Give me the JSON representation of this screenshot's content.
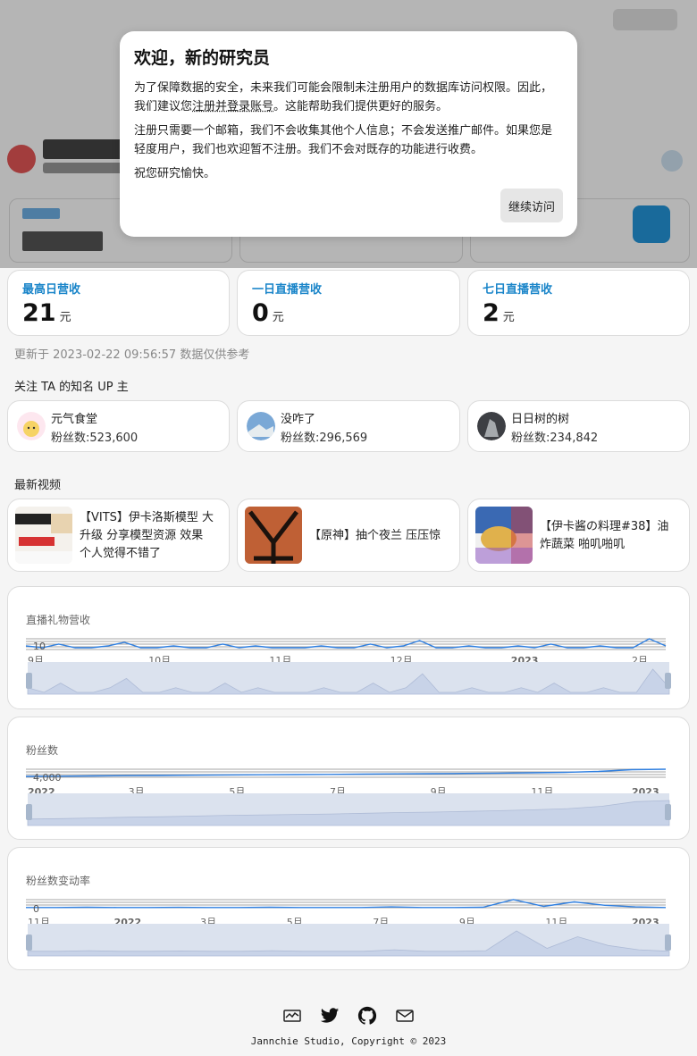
{
  "modal": {
    "title": "欢迎，新的研究员",
    "p1_before": "为了保障数据的安全，未来我们可能会限制未注册用户的数据库访问权限。因此，我们建议您",
    "p1_link": "注册并登录账号",
    "p1_after": "。这能帮助我们提供更好的服务。",
    "p2": "注册只需要一个邮箱，我们不会收集其他个人信息；不会发送推广邮件。如果您是轻度用户，我们也欢迎暂不注册。我们不会对既存的功能进行收费。",
    "p3": "祝您研究愉快。",
    "continue_label": "继续访问"
  },
  "stats": [
    {
      "label": "最高日营收",
      "value": "21",
      "unit": "元"
    },
    {
      "label": "一日直播营收",
      "value": "0",
      "unit": "元"
    },
    {
      "label": "七日直播营收",
      "value": "2",
      "unit": "元"
    }
  ],
  "update_line": "更新于 2023-02-22 09:56:57 数据仅供参考",
  "follow_title": "关注 TA 的知名 UP 主",
  "ups": [
    {
      "name": "元气食堂",
      "fans": "粉丝数:523,600"
    },
    {
      "name": "没咋了",
      "fans": "粉丝数:296,569"
    },
    {
      "name": "日日树的树",
      "fans": "粉丝数:234,842"
    }
  ],
  "videos_title": "最新视频",
  "videos": [
    {
      "title_line1": "【VITS】伊卡洛斯模型 大",
      "title_line2": "升级 分享模型资源 效果",
      "title_line3": "个人觉得不错了"
    },
    {
      "title_line1": "【原神】抽个夜兰 压压惊"
    },
    {
      "title_line1": "【伊卡酱の料理#38】油",
      "title_line2": "炸蔬菜 啪叽啪叽"
    }
  ],
  "charts": [
    {
      "title": "直播礼物营收",
      "ytick": "10",
      "xticks": [
        "9月",
        "10月",
        "11月",
        "12月",
        "2023",
        "2月"
      ]
    },
    {
      "title": "粉丝数",
      "ytick": "4,000",
      "xticks": [
        "2022",
        "3月",
        "5月",
        "7月",
        "9月",
        "11月",
        "2023"
      ]
    },
    {
      "title": "粉丝数变动率",
      "ytick": "0",
      "xticks": [
        "11月",
        "2022",
        "3月",
        "5月",
        "7月",
        "9月",
        "11月",
        "2023"
      ]
    }
  ],
  "chart_data": [
    {
      "type": "area",
      "title": "直播礼物营收",
      "x": [
        "9月",
        "10月",
        "11月",
        "12月",
        "2023",
        "2月"
      ],
      "series": [
        {
          "values": [
            1,
            0,
            2,
            0,
            0,
            1,
            3,
            0,
            0,
            1,
            0,
            0,
            2,
            0,
            1,
            0,
            0,
            0,
            1,
            0,
            0,
            2,
            0,
            1,
            4,
            0,
            0,
            1,
            0,
            0,
            1,
            0,
            2,
            0,
            0,
            1,
            0,
            0,
            5,
            1
          ]
        }
      ]
    },
    {
      "type": "area",
      "title": "粉丝数",
      "x": [
        "2022",
        "3月",
        "5月",
        "7月",
        "9月",
        "11月",
        "2023"
      ],
      "series": [
        {
          "values": [
            0.2,
            0.22,
            0.25,
            0.28,
            0.3,
            0.33,
            0.36,
            0.38,
            0.4,
            0.42,
            0.45,
            0.48,
            0.5,
            0.53,
            0.56,
            0.6,
            0.65,
            0.75,
            0.95,
            1.0
          ]
        }
      ]
    },
    {
      "type": "area",
      "title": "粉丝数变动率",
      "x": [
        "11月",
        "2022",
        "3月",
        "5月",
        "7月",
        "9月",
        "11月",
        "2023"
      ],
      "series": [
        {
          "values": [
            0.1,
            0.1,
            0.12,
            0.1,
            0.1,
            0.11,
            0.1,
            0.1,
            0.12,
            0.1,
            0.1,
            0.1,
            0.15,
            0.1,
            0.1,
            0.12,
            0.8,
            0.2,
            0.6,
            0.3,
            0.15,
            0.1
          ]
        }
      ]
    }
  ],
  "footer": {
    "copyright": "Jannchie Studio, Copyright © 2023"
  },
  "icons": [
    "chart-icon",
    "twitter-icon",
    "github-icon",
    "mail-icon"
  ]
}
